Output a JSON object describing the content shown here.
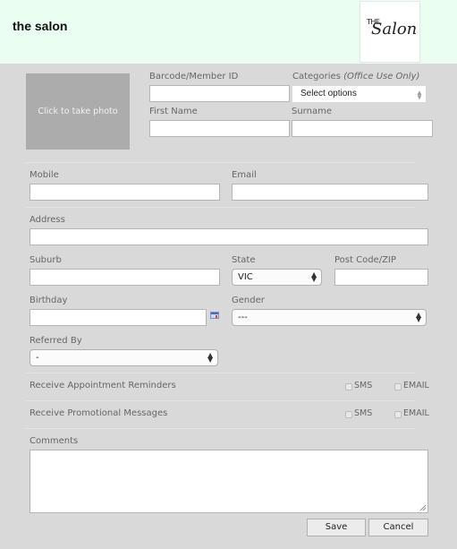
{
  "header": {
    "app_title": "the salon",
    "logo": {
      "small": "THE",
      "main": "Salon"
    },
    "background_color": "#eafff1"
  },
  "photo": {
    "label": "Click to take photo"
  },
  "fields": {
    "barcode": {
      "label": "Barcode/Member ID",
      "value": ""
    },
    "categories": {
      "label": "Categories",
      "label_note": "(Office Use Only)",
      "selected": "Select options"
    },
    "first_name": {
      "label": "First Name",
      "value": ""
    },
    "surname": {
      "label": "Surname",
      "value": ""
    },
    "mobile": {
      "label": "Mobile",
      "value": ""
    },
    "email": {
      "label": "Email",
      "value": ""
    },
    "address": {
      "label": "Address",
      "value": ""
    },
    "suburb": {
      "label": "Suburb",
      "value": ""
    },
    "state": {
      "label": "State",
      "selected": "VIC"
    },
    "postcode": {
      "label": "Post Code/ZIP",
      "value": ""
    },
    "birthday": {
      "label": "Birthday",
      "value": ""
    },
    "gender": {
      "label": "Gender",
      "selected": "---"
    },
    "referred_by": {
      "label": "Referred By",
      "selected": "-"
    },
    "comments": {
      "label": "Comments",
      "value": ""
    }
  },
  "preferences": {
    "appointment_reminders": {
      "label": "Receive Appointment Reminders",
      "sms_label": "SMS",
      "email_label": "EMAIL",
      "sms": false,
      "email": false
    },
    "promotional_messages": {
      "label": "Receive Promotional Messages",
      "sms_label": "SMS",
      "email_label": "EMAIL",
      "sms": false,
      "email": false
    }
  },
  "actions": {
    "save_label": "Save",
    "cancel_label": "Cancel"
  }
}
